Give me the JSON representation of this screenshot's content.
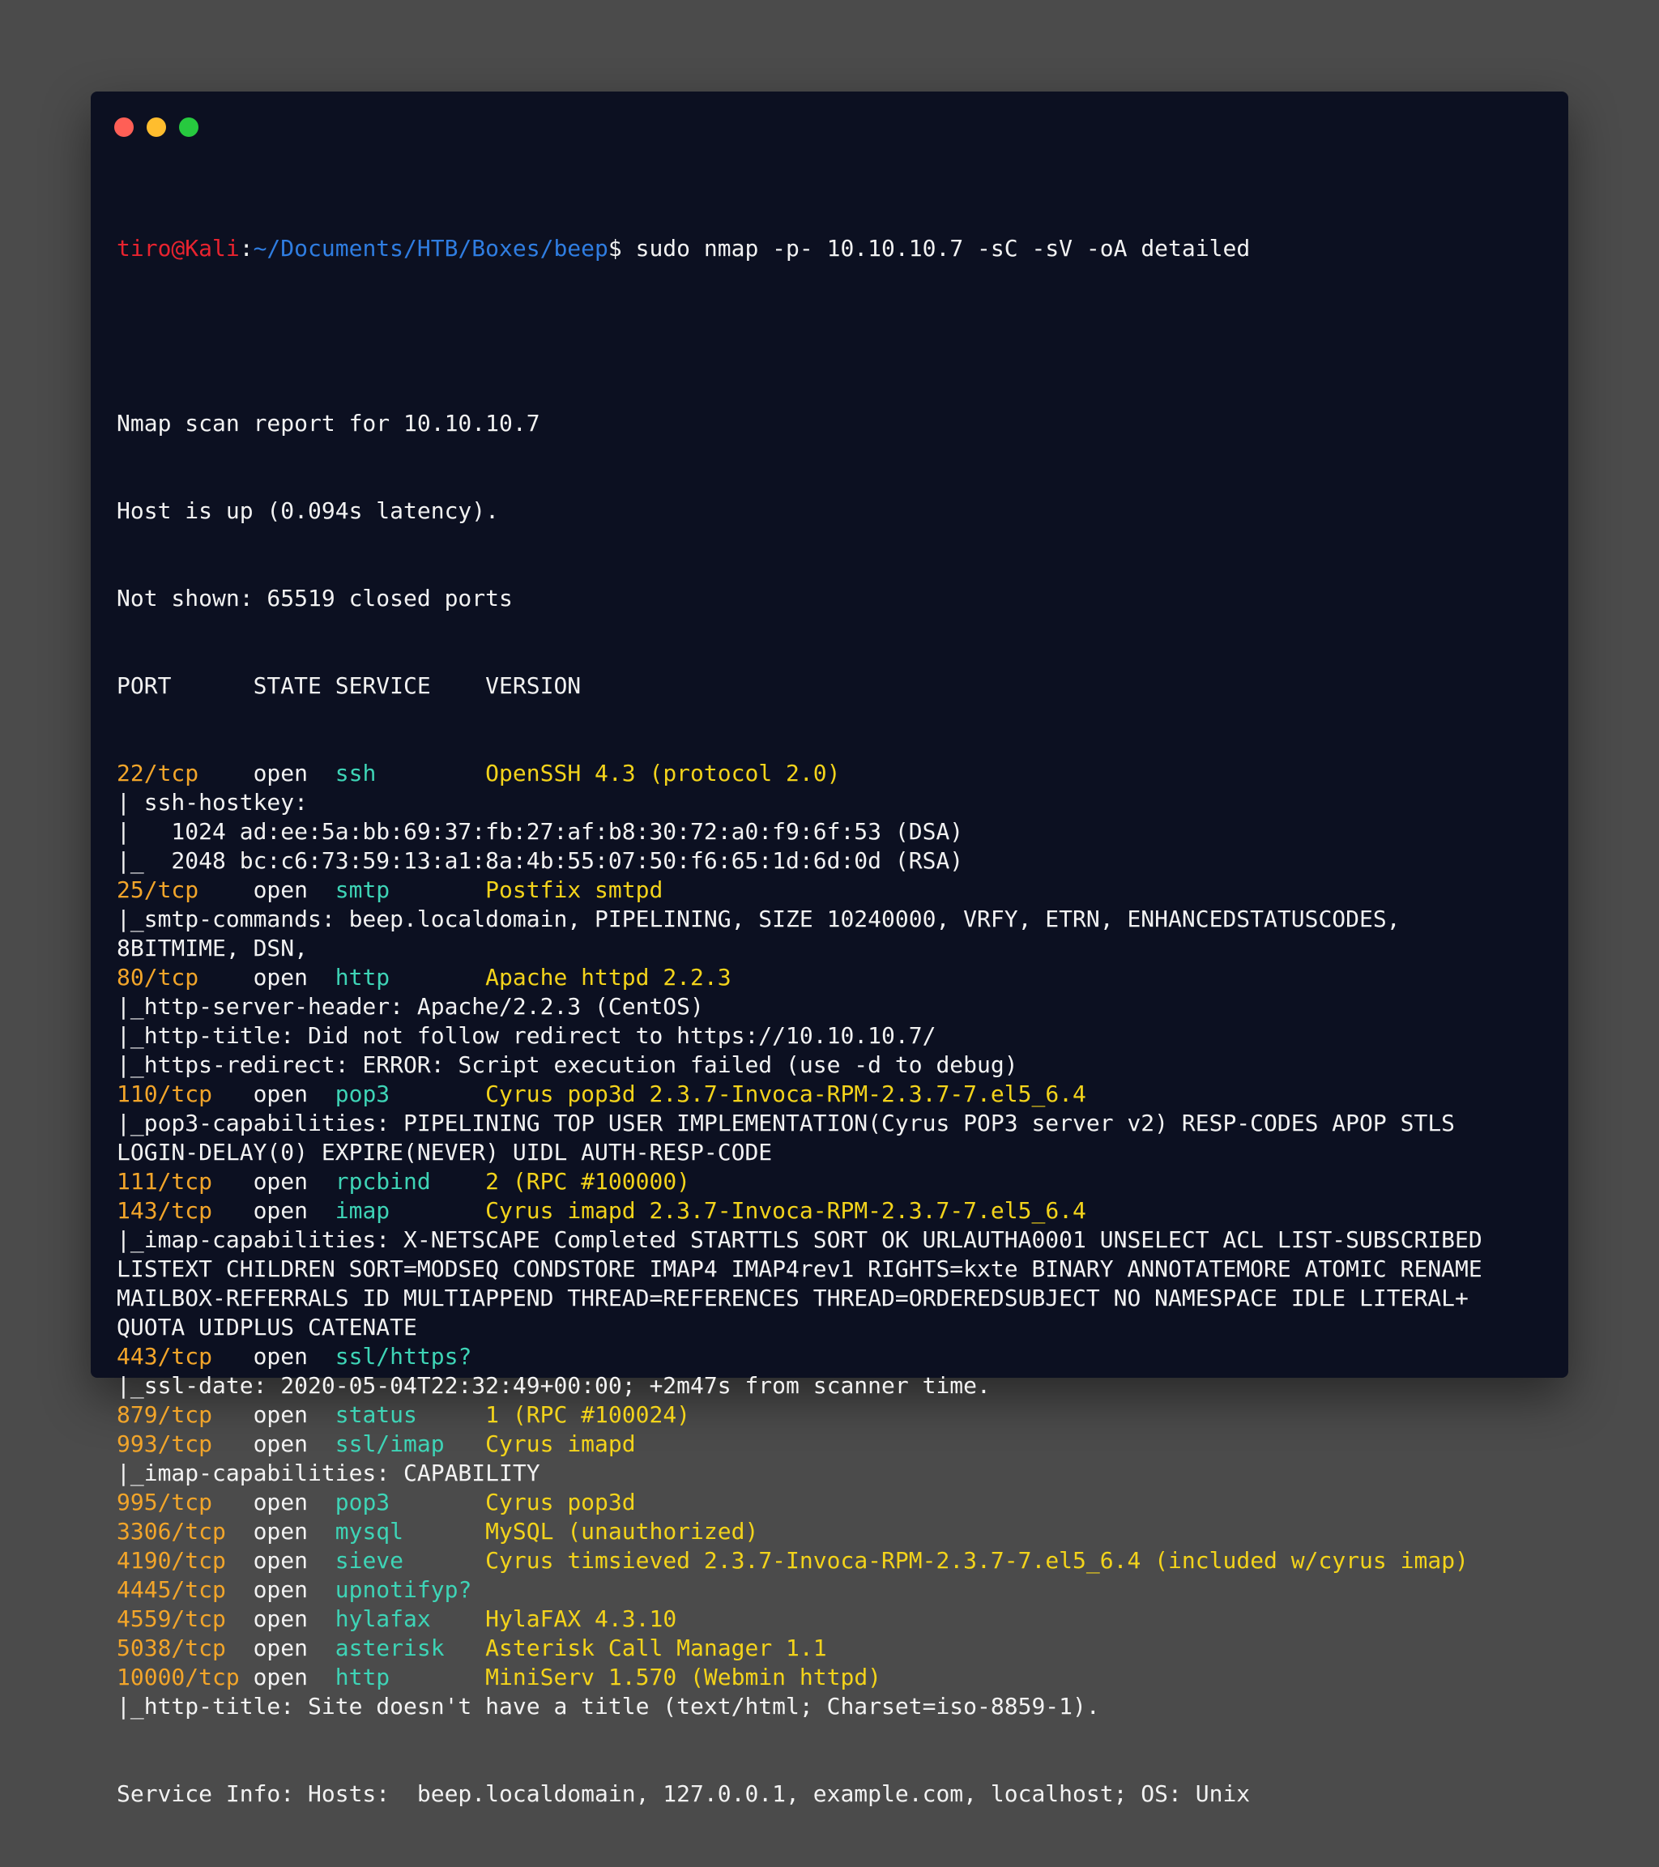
{
  "window": {
    "controls": [
      "close",
      "minimize",
      "maximize"
    ],
    "colors": {
      "close": "#ff5f56",
      "minimize": "#ffbd2e",
      "maximize": "#27c93f"
    }
  },
  "prompt": {
    "user_host": "tiro@Kali",
    "separator": ":",
    "path": "~/Documents/HTB/Boxes/beep",
    "symbol": "$",
    "command": " sudo nmap -p- 10.10.10.7 -sC -sV -oA detailed"
  },
  "header": [
    "Nmap scan report for 10.10.10.7",
    "Host is up (0.094s latency).",
    "Not shown: 65519 closed ports",
    "PORT      STATE SERVICE    VERSION"
  ],
  "ports": [
    {
      "port": "22/tcp",
      "state": "open",
      "service": "ssh",
      "version": "OpenSSH 4.3 (protocol 2.0)",
      "details": [
        "| ssh-hostkey:",
        "|   1024 ad:ee:5a:bb:69:37:fb:27:af:b8:30:72:a0:f9:6f:53 (DSA)",
        "|_  2048 bc:c6:73:59:13:a1:8a:4b:55:07:50:f6:65:1d:6d:0d (RSA)"
      ]
    },
    {
      "port": "25/tcp",
      "state": "open",
      "service": "smtp",
      "version": "Postfix smtpd",
      "details": [
        "|_smtp-commands: beep.localdomain, PIPELINING, SIZE 10240000, VRFY, ETRN, ENHANCEDSTATUSCODES,",
        "8BITMIME, DSN,"
      ]
    },
    {
      "port": "80/tcp",
      "state": "open",
      "service": "http",
      "version": "Apache httpd 2.2.3",
      "details": [
        "|_http-server-header: Apache/2.2.3 (CentOS)",
        "|_http-title: Did not follow redirect to https://10.10.10.7/",
        "|_https-redirect: ERROR: Script execution failed (use -d to debug)"
      ]
    },
    {
      "port": "110/tcp",
      "state": "open",
      "service": "pop3",
      "version": "Cyrus pop3d 2.3.7-Invoca-RPM-2.3.7-7.el5_6.4",
      "details": [
        "|_pop3-capabilities: PIPELINING TOP USER IMPLEMENTATION(Cyrus POP3 server v2) RESP-CODES APOP STLS",
        "LOGIN-DELAY(0) EXPIRE(NEVER) UIDL AUTH-RESP-CODE"
      ]
    },
    {
      "port": "111/tcp",
      "state": "open",
      "service": "rpcbind",
      "version": "2 (RPC #100000)",
      "details": []
    },
    {
      "port": "143/tcp",
      "state": "open",
      "service": "imap",
      "version": "Cyrus imapd 2.3.7-Invoca-RPM-2.3.7-7.el5_6.4",
      "details": [
        "|_imap-capabilities: X-NETSCAPE Completed STARTTLS SORT OK URLAUTHA0001 UNSELECT ACL LIST-SUBSCRIBED",
        "LISTEXT CHILDREN SORT=MODSEQ CONDSTORE IMAP4 IMAP4rev1 RIGHTS=kxte BINARY ANNOTATEMORE ATOMIC RENAME",
        "MAILBOX-REFERRALS ID MULTIAPPEND THREAD=REFERENCES THREAD=ORDEREDSUBJECT NO NAMESPACE IDLE LITERAL+",
        "QUOTA UIDPLUS CATENATE"
      ]
    },
    {
      "port": "443/tcp",
      "state": "open",
      "service": "ssl/https?",
      "version": "",
      "details": [
        "|_ssl-date: 2020-05-04T22:32:49+00:00; +2m47s from scanner time."
      ]
    },
    {
      "port": "879/tcp",
      "state": "open",
      "service": "status",
      "version": "1 (RPC #100024)",
      "details": []
    },
    {
      "port": "993/tcp",
      "state": "open",
      "service": "ssl/imap",
      "version": "Cyrus imapd",
      "details": [
        "|_imap-capabilities: CAPABILITY"
      ]
    },
    {
      "port": "995/tcp",
      "state": "open",
      "service": "pop3",
      "version": "Cyrus pop3d",
      "details": []
    },
    {
      "port": "3306/tcp",
      "state": "open",
      "service": "mysql",
      "version": "MySQL (unauthorized)",
      "details": []
    },
    {
      "port": "4190/tcp",
      "state": "open",
      "service": "sieve",
      "version": "Cyrus timsieved 2.3.7-Invoca-RPM-2.3.7-7.el5_6.4 (included w/cyrus imap)",
      "details": []
    },
    {
      "port": "4445/tcp",
      "state": "open",
      "service": "upnotifyp?",
      "version": "",
      "details": []
    },
    {
      "port": "4559/tcp",
      "state": "open",
      "service": "hylafax",
      "version": "HylaFAX 4.3.10",
      "details": []
    },
    {
      "port": "5038/tcp",
      "state": "open",
      "service": "asterisk",
      "version": "Asterisk Call Manager 1.1",
      "details": []
    },
    {
      "port": "10000/tcp",
      "state": "open",
      "service": "http",
      "version": "MiniServ 1.570 (Webmin httpd)",
      "details": [
        "|_http-title: Site doesn't have a title (text/html; Charset=iso-8859-1)."
      ]
    }
  ],
  "footer": "Service Info: Hosts:  beep.localdomain, 127.0.0.1, example.com, localhost; OS: Unix"
}
